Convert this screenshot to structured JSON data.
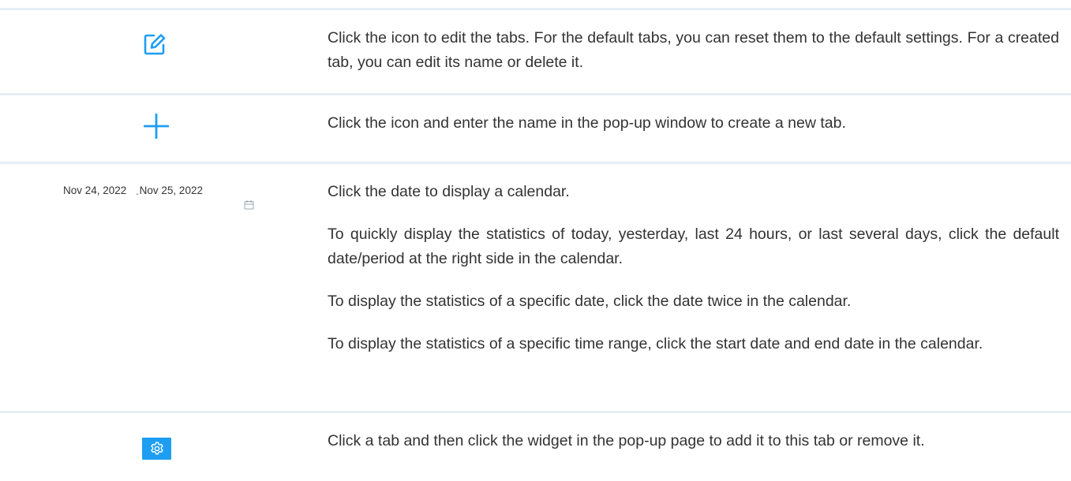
{
  "rows": [
    {
      "icon": "edit-icon",
      "text": "Click the icon to edit the tabs. For the default tabs, you can reset them to the default settings. For a created tab, you can edit its name or delete it."
    },
    {
      "icon": "plus-icon",
      "text": "Click the icon and enter the name in the pop-up window to create a new tab."
    },
    {
      "date_range": {
        "start": "Nov 24, 2022",
        "separator": "-",
        "end": "Nov 25, 2022",
        "icon": "calendar-icon"
      },
      "paragraphs": [
        "Click the date to display a calendar.",
        "To quickly display the statistics of today, yesterday, last 24 hours, or last several days, click the default date/period at the right side in the calendar.",
        "To display the statistics of a specific date, click the date twice in the calendar.",
        "To display the statistics of a specific time range, click the start date and end date in the calendar."
      ]
    },
    {
      "icon": "gear-icon",
      "text": "Click a tab and then click the widget in the pop-up page to add it to this tab or remove it."
    }
  ],
  "colors": {
    "accent": "#1e9ef2",
    "divider": "#e6edf3",
    "text": "#333333"
  }
}
